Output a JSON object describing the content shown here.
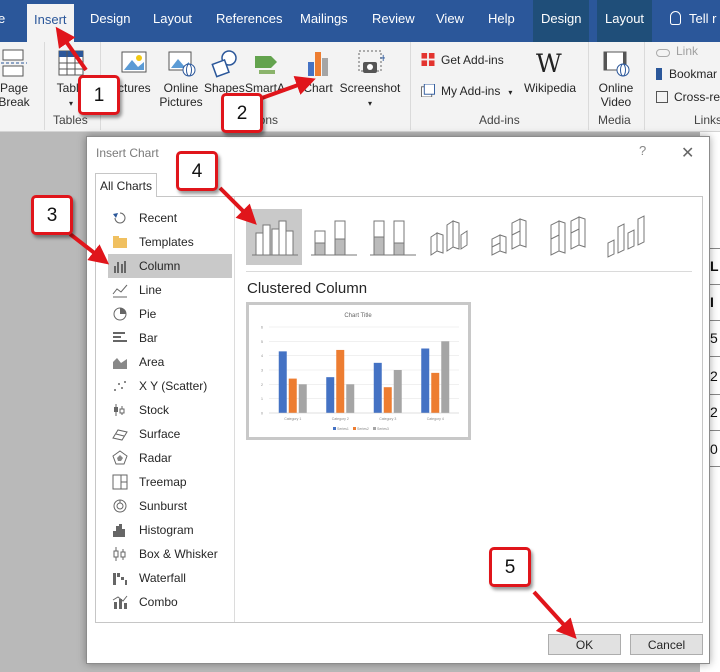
{
  "tabs": [
    {
      "label": "e"
    },
    {
      "label": "Insert"
    },
    {
      "label": "Design"
    },
    {
      "label": "Layout"
    },
    {
      "label": "References"
    },
    {
      "label": "Mailings"
    },
    {
      "label": "Review"
    },
    {
      "label": "View"
    },
    {
      "label": "Help"
    },
    {
      "label": "Design"
    },
    {
      "label": "Layout"
    }
  ],
  "tell_me": "Tell r",
  "ribbon": {
    "page_break": [
      "Page",
      "Break"
    ],
    "table": "Table",
    "pictures": "ictures",
    "online_pictures": [
      "Online",
      "Pictures"
    ],
    "shapes": "Shapes",
    "smartart": "SmartA",
    "chart": "Chart",
    "screenshot": "Screenshot",
    "get_addins": "Get Add-ins",
    "my_addins": "My Add-ins",
    "wikipedia": "Wikipedia",
    "online_video": [
      "Online",
      "Video"
    ],
    "link": "Link",
    "bookmark": "Bookmar",
    "cross_ref": "Cross-ref",
    "groups": {
      "tables": "Tables",
      "illustrations": "ions",
      "addins": "Add-ins",
      "media": "Media",
      "links": "Links"
    }
  },
  "document_cells": [
    "L",
    "I",
    "5",
    "2",
    "2",
    "0"
  ],
  "dialog": {
    "title": "Insert Chart",
    "help": "?",
    "close": "✕",
    "tab": "All Charts",
    "categories": [
      "Recent",
      "Templates",
      "Column",
      "Line",
      "Pie",
      "Bar",
      "Area",
      "X Y (Scatter)",
      "Stock",
      "Surface",
      "Radar",
      "Treemap",
      "Sunburst",
      "Histogram",
      "Box & Whisker",
      "Waterfall",
      "Combo"
    ],
    "selected_category": "Column",
    "chart_type_title": "Clustered Column",
    "ok": "OK",
    "cancel": "Cancel",
    "preview": {
      "title": "Chart Title",
      "y_ticks": [
        "0",
        "1",
        "2",
        "3",
        "4",
        "5",
        "6"
      ],
      "categories": [
        "Category 1",
        "Category 2",
        "Category 3",
        "Category 4"
      ],
      "series": [
        {
          "name": "Series1",
          "values": [
            4.3,
            2.5,
            3.5,
            4.5
          ],
          "color": "#4472c4"
        },
        {
          "name": "Series2",
          "values": [
            2.4,
            4.4,
            1.8,
            2.8
          ],
          "color": "#ed7d31"
        },
        {
          "name": "Series3",
          "values": [
            2.0,
            2.0,
            3.0,
            5.0
          ],
          "color": "#a5a5a5"
        }
      ]
    }
  },
  "callouts": [
    "1",
    "2",
    "3",
    "4",
    "5"
  ],
  "colors": {
    "ribbon": "#2b579a",
    "callout_border": "#e0151b",
    "selected": "#c9c9c9"
  }
}
